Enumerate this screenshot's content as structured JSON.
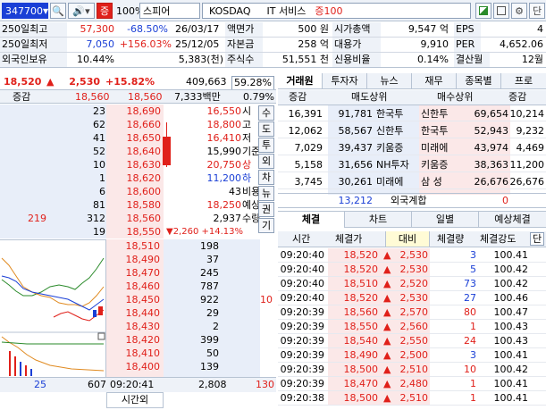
{
  "toolbar": {
    "code": "347700",
    "credit_badge": "증",
    "rate": "100%",
    "name": "스피어",
    "market": "KOSDAQ",
    "sector": "IT 서비스",
    "margin": "증100"
  },
  "info": {
    "row1": {
      "label": "250일최고",
      "price": "57,300",
      "pct": "-68.50%",
      "date": "26/03/17",
      "k1": "액면가",
      "v1": "500 원",
      "k2": "시가총액",
      "v2": "9,547 억",
      "k3": "EPS",
      "v3": "4"
    },
    "row2": {
      "label": "250일최저",
      "price": "7,050",
      "pct": "+156.03%",
      "date": "25/12/05",
      "k1": "자본금",
      "v1": "258 억",
      "k2": "대용가",
      "v2": "9,910",
      "k3": "PER",
      "v3": "4,652.06"
    },
    "row3": {
      "label": "외국인보유",
      "pct": "10.44%",
      "qty": "5,383(천)",
      "k1": "주식수",
      "v1": "51,551 천",
      "k2": "신용비율",
      "v2": "0.14%",
      "k3": "결산월",
      "v3": "12월"
    }
  },
  "quote": {
    "price": "18,520",
    "arrow": "▲",
    "change": "2,530",
    "pct": "+15.82%",
    "volume": "409,663",
    "vol_pct": "59.28%"
  },
  "quote2": {
    "label": "증감",
    "price": "18,560",
    "price2": "18,560",
    "amount": "7,333백만",
    "pct": "0.79%"
  },
  "side_tabs": [
    "수",
    "도",
    "투",
    "외",
    "차",
    "뉴",
    "권",
    "기"
  ],
  "asks": [
    {
      "qty": "23",
      "price": "18,690"
    },
    {
      "qty": "62",
      "price": "18,660"
    },
    {
      "qty": "41",
      "price": "18,650"
    },
    {
      "qty": "52",
      "price": "18,640"
    },
    {
      "qty": "10",
      "price": "18,630"
    },
    {
      "qty": "1",
      "price": "18,620"
    },
    {
      "qty": "6",
      "price": "18,600"
    },
    {
      "qty": "81",
      "price": "18,580"
    },
    {
      "qty": "312",
      "price": "18,560",
      "diff": "219"
    },
    {
      "qty": "19",
      "price": "18,550"
    }
  ],
  "stats": [
    {
      "v": "16,550",
      "k": "시"
    },
    {
      "v": "18,800",
      "k": "고"
    },
    {
      "v": "16,410",
      "k": "저"
    },
    {
      "v": "15,990",
      "k": "기준"
    },
    {
      "v": "20,750",
      "k": "상"
    },
    {
      "v": "11,200",
      "k": "하"
    },
    {
      "v": "43",
      "k": "비용"
    },
    {
      "v": "18,250",
      "k": "예상"
    },
    {
      "v": "2,937",
      "k": "수량"
    },
    {
      "v": "▼2,260 +14.13%",
      "k": ""
    }
  ],
  "bids": [
    {
      "price": "18,510",
      "qty": "198"
    },
    {
      "price": "18,490",
      "qty": "37"
    },
    {
      "price": "18,470",
      "qty": "245"
    },
    {
      "price": "18,460",
      "qty": "787"
    },
    {
      "price": "18,450",
      "qty": "922",
      "diff": "10"
    },
    {
      "price": "18,440",
      "qty": "29"
    },
    {
      "price": "18,430",
      "qty": "2"
    },
    {
      "price": "18,420",
      "qty": "399"
    },
    {
      "price": "18,410",
      "qty": "50"
    },
    {
      "price": "18,400",
      "qty": "139"
    }
  ],
  "footer": {
    "ask_total": "25",
    "ask_total2": "607",
    "time": "09:20:41",
    "bid_total": "2,808",
    "bid_diff": "130",
    "label": "시간외"
  },
  "broker_tabs": [
    "거래원",
    "투자자",
    "뉴스",
    "재무",
    "종목별",
    "프로"
  ],
  "broker_head": {
    "c1": "증감",
    "c2": "매도상위",
    "c3": "매수상위",
    "c4": "증감"
  },
  "brokers": [
    {
      "d1": "16,391",
      "sq": "91,781",
      "sn": "한국투",
      "bn": "신한투",
      "bq": "69,654",
      "d2": "10,214"
    },
    {
      "d1": "12,062",
      "sq": "58,567",
      "sn": "신한투",
      "bn": "한국투",
      "bq": "52,943",
      "d2": "9,232"
    },
    {
      "d1": "7,029",
      "sq": "39,437",
      "sn": "키움증",
      "bn": "미래에",
      "bq": "43,974",
      "d2": "4,469"
    },
    {
      "d1": "5,158",
      "sq": "31,656",
      "sn": "NH투자",
      "bn": "키움증",
      "bq": "38,363",
      "d2": "11,200"
    },
    {
      "d1": "3,745",
      "sq": "30,261",
      "sn": "미래에",
      "bn": "삼 성",
      "bq": "26,676",
      "d2": "26,676"
    }
  ],
  "broker_foot": {
    "v": "13,212",
    "label": "외국계합",
    "v2": "0"
  },
  "trade_tabs": [
    "체결",
    "차트",
    "일별",
    "예상체결"
  ],
  "trade_head": {
    "c1": "시간",
    "c2": "체결가",
    "c3": "대비",
    "c4": "체결량",
    "c5": "체결강도",
    "c6": "단"
  },
  "trades": [
    {
      "t": "09:20:40",
      "p": "18,520",
      "d": "2,530",
      "q": "3",
      "s": "100.41",
      "qc": "blue"
    },
    {
      "t": "09:20:40",
      "p": "18,520",
      "d": "2,530",
      "q": "5",
      "s": "100.42",
      "qc": "blue"
    },
    {
      "t": "09:20:40",
      "p": "18,510",
      "d": "2,520",
      "q": "73",
      "s": "100.42",
      "qc": "blue"
    },
    {
      "t": "09:20:40",
      "p": "18,520",
      "d": "2,530",
      "q": "27",
      "s": "100.46",
      "qc": "blue"
    },
    {
      "t": "09:20:39",
      "p": "18,560",
      "d": "2,570",
      "q": "80",
      "s": "100.47",
      "qc": "red"
    },
    {
      "t": "09:20:39",
      "p": "18,550",
      "d": "2,560",
      "q": "1",
      "s": "100.43",
      "qc": "red"
    },
    {
      "t": "09:20:39",
      "p": "18,540",
      "d": "2,550",
      "q": "24",
      "s": "100.43",
      "qc": "red"
    },
    {
      "t": "09:20:39",
      "p": "18,490",
      "d": "2,500",
      "q": "3",
      "s": "100.41",
      "qc": "blue"
    },
    {
      "t": "09:20:39",
      "p": "18,500",
      "d": "2,510",
      "q": "10",
      "s": "100.42",
      "qc": "red"
    },
    {
      "t": "09:20:39",
      "p": "18,470",
      "d": "2,480",
      "q": "1",
      "s": "100.41",
      "qc": "red"
    },
    {
      "t": "09:20:38",
      "p": "18,500",
      "d": "2,510",
      "q": "1",
      "s": "100.41",
      "qc": "red"
    }
  ],
  "colors": {
    "up": "#e0201a",
    "down": "#1a3fd6",
    "header_bg": "#eef2f8"
  }
}
